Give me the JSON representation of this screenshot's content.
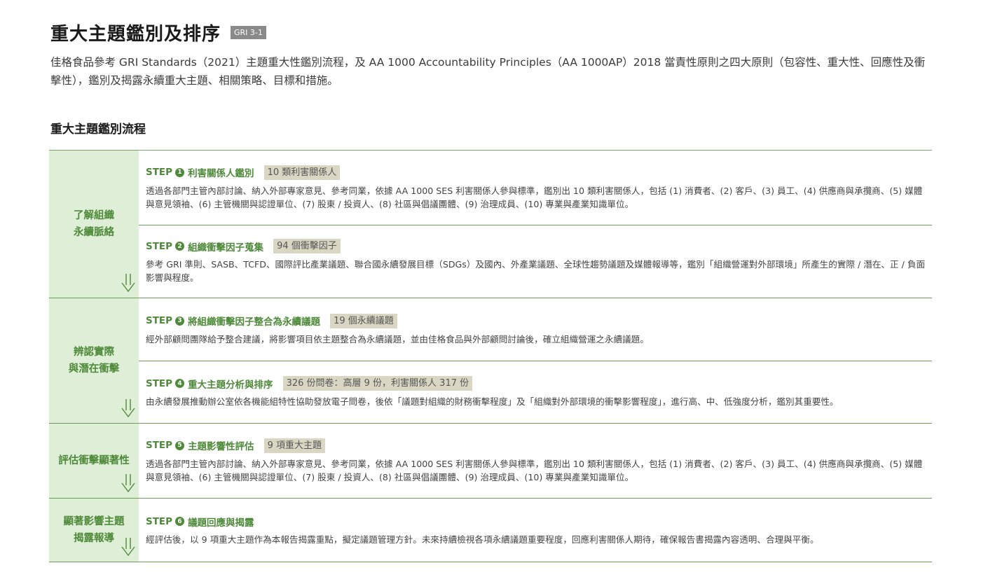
{
  "page": {
    "title": "重大主題鑑別及排序",
    "badge": "GRI 3-1",
    "intro": "佳格食品參考 GRI Standards（2021）主題重大性鑑別流程，及 AA 1000 Accountability Principles（AA 1000AP）2018 當責性原則之四大原則（包容性、重大性、回應性及衝擊性），鑑別及揭露永續重大主題、相關策略、目標和措施。",
    "section_title": "重大主題鑑別流程"
  },
  "step_word": "STEP",
  "colors": {
    "accent_green": "#4e8a3a",
    "label_bg": "#dfeed6",
    "tag_bg": "#d9d7c3",
    "rule_green": "#6a9e5a"
  },
  "icons": {
    "phase_arrow": "down-arrow-icon",
    "step_number": "circled-number-icon"
  },
  "phases": [
    {
      "label": "了解組織\n永續脈絡",
      "steps": [
        {
          "num": "1",
          "title": "利害關係人鑑別",
          "tag": "10 類利害關係人",
          "desc": "透過各部門主管內部討論、納入外部專家意見、參考同業，依據 AA 1000 SES 利害關係人參與標準，鑑別出 10 類利害關係人，包括 (1) 消費者、(2) 客戶、(3) 員工、(4) 供應商與承攬商、(5) 媒體與意見領袖、(6) 主管機關與認證單位、(7) 股東 / 投資人、(8) 社區與倡議團體、(9) 治理成員、(10) 專業與產業知識單位。"
        },
        {
          "num": "2",
          "title": "組織衝擊因子蒐集",
          "tag": "94 個衝擊因子",
          "desc": "參考 GRI 準則、SASB、TCFD、國際評比產業議題、聯合國永續發展目標（SDGs）及國內、外產業議題、全球性趨勢議題及媒體報導等，鑑別「組織營運對外部環境」所產生的實際 / 潛在、正 / 負面影響與程度。"
        }
      ]
    },
    {
      "label": "辨認實際\n與潛在衝擊",
      "steps": [
        {
          "num": "3",
          "title": "將組織衝擊因子整合為永續議題",
          "tag": "19 個永續議題",
          "desc": "經外部顧問團隊給予整合建議，將影響項目依主題整合為永續議題，並由佳格食品與外部顧問討論後，確立組織營運之永續議題。"
        },
        {
          "num": "4",
          "title": "重大主題分析與排序",
          "tag": "326 份問卷：高層 9 份，利害關係人 317 份",
          "desc": "由永續發展推動辦公室依各機能組特性協助發放電子問卷，後依「議題對組織的財務衝擊程度」及「組織對外部環境的衝擊影響程度」，進行高、中、低強度分析，鑑別其重要性。"
        }
      ]
    },
    {
      "label": "評估衝擊顯著性",
      "steps": [
        {
          "num": "5",
          "title": "主題影響性評估",
          "tag": "9 項重大主題",
          "desc": "透過各部門主管內部討論、納入外部專家意見、參考同業，依據 AA 1000 SES 利害關係人參與標準，鑑別出 10 類利害關係人，包括 (1) 消費者、(2) 客戶、(3) 員工、(4) 供應商與承攬商、(5) 媒體與意見領袖、(6) 主管機關與認證單位、(7) 股東 / 投資人、(8) 社區與倡議團體、(9) 治理成員、(10) 專業與產業知識單位。"
        }
      ]
    },
    {
      "label": "顯著影響主題\n揭露報導",
      "steps": [
        {
          "num": "6",
          "title": "議題回應與揭露",
          "tag": "",
          "desc": "經評估後，以 9 項重大主題作為本報告揭露重點，擬定議題管理方針。未來持續檢視各項永續議題重要程度，回應利害關係人期待，確保報告書揭露內容透明、合理與平衡。"
        }
      ]
    }
  ]
}
